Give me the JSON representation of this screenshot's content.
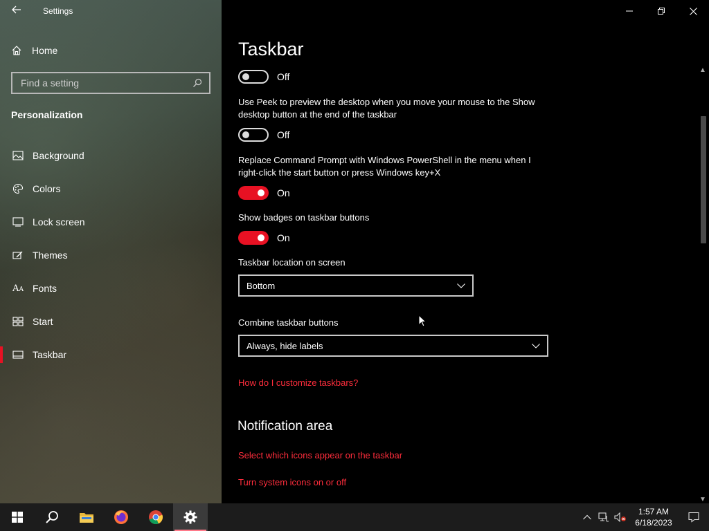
{
  "window": {
    "app_title": "Settings"
  },
  "sidebar": {
    "home_label": "Home",
    "search_placeholder": "Find a setting",
    "section_title": "Personalization",
    "items": [
      {
        "label": "Background",
        "icon": "image-icon"
      },
      {
        "label": "Colors",
        "icon": "palette-icon"
      },
      {
        "label": "Lock screen",
        "icon": "lock-screen-icon"
      },
      {
        "label": "Themes",
        "icon": "themes-icon"
      },
      {
        "label": "Fonts",
        "icon": "fonts-icon"
      },
      {
        "label": "Start",
        "icon": "start-icon"
      },
      {
        "label": "Taskbar",
        "icon": "taskbar-icon",
        "active": true
      }
    ]
  },
  "main": {
    "title": "Taskbar",
    "toggle_1": {
      "state_label": "Off"
    },
    "peek": {
      "description": "Use Peek to preview the desktop when you move your mouse to the Show desktop button at the end of the taskbar",
      "state_label": "Off"
    },
    "powershell": {
      "description": "Replace Command Prompt with Windows PowerShell in the menu when I right-click the start button or press Windows key+X",
      "state_label": "On"
    },
    "badges": {
      "description": "Show badges on taskbar buttons",
      "state_label": "On"
    },
    "location": {
      "label": "Taskbar location on screen",
      "value": "Bottom"
    },
    "combine": {
      "label": "Combine taskbar buttons",
      "value": "Always, hide labels"
    },
    "help_link": "How do I customize taskbars?",
    "notification": {
      "heading": "Notification area",
      "link_icons": "Select which icons appear on the taskbar",
      "link_system": "Turn system icons on or off"
    }
  },
  "taskbar": {
    "apps": [
      "start-icon",
      "search-icon",
      "file-explorer-icon",
      "firefox-icon",
      "chrome-icon",
      "settings-icon"
    ],
    "clock": {
      "time": "1:57 AM",
      "date": "6/18/2023"
    }
  },
  "colors": {
    "accent": "#e81123",
    "link": "#ff2d3c"
  }
}
